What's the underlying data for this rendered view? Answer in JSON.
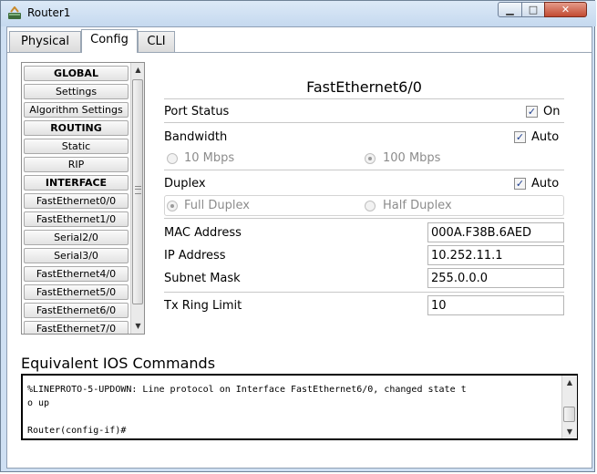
{
  "window": {
    "title": "Router1",
    "minimize_glyph": "▁",
    "maximize_glyph": "□",
    "close_glyph": "✕"
  },
  "tabs": [
    {
      "label": "Physical"
    },
    {
      "label": "Config",
      "active": true
    },
    {
      "label": "CLI"
    }
  ],
  "sidebar": {
    "items": [
      {
        "label": "GLOBAL",
        "header": true
      },
      {
        "label": "Settings"
      },
      {
        "label": "Algorithm Settings"
      },
      {
        "label": "ROUTING",
        "header": true
      },
      {
        "label": "Static"
      },
      {
        "label": "RIP"
      },
      {
        "label": "INTERFACE",
        "header": true
      },
      {
        "label": "FastEthernet0/0"
      },
      {
        "label": "FastEthernet1/0"
      },
      {
        "label": "Serial2/0"
      },
      {
        "label": "Serial3/0"
      },
      {
        "label": "FastEthernet4/0"
      },
      {
        "label": "FastEthernet5/0"
      },
      {
        "label": "FastEthernet6/0",
        "selected": true
      },
      {
        "label": "FastEthernet7/0"
      }
    ],
    "scroll_up_glyph": "▲",
    "scroll_down_glyph": "▼"
  },
  "panel": {
    "title": "FastEthernet6/0",
    "port_status": {
      "label": "Port Status",
      "checkbox_label": "On",
      "checked": true
    },
    "bandwidth": {
      "label": "Bandwidth",
      "auto_label": "Auto",
      "auto_checked": true,
      "options": [
        "10 Mbps",
        "100 Mbps"
      ],
      "selected": "100 Mbps"
    },
    "duplex": {
      "label": "Duplex",
      "auto_label": "Auto",
      "auto_checked": true,
      "options": [
        "Full Duplex",
        "Half Duplex"
      ],
      "selected": "Full Duplex"
    },
    "mac_address": {
      "label": "MAC Address",
      "value": "000A.F38B.6AED"
    },
    "ip_address": {
      "label": "IP Address",
      "value": "10.252.11.1"
    },
    "subnet_mask": {
      "label": "Subnet Mask",
      "value": "255.0.0.0"
    },
    "tx_ring_limit": {
      "label": "Tx Ring Limit",
      "value": "10"
    }
  },
  "ios": {
    "title": "Equivalent IOS Commands",
    "output": "%LINEPROTO-5-UPDOWN: Line protocol on Interface FastEthernet6/0, changed state t\no up\n\nRouter(config-if)#"
  },
  "check_glyph": "✓"
}
